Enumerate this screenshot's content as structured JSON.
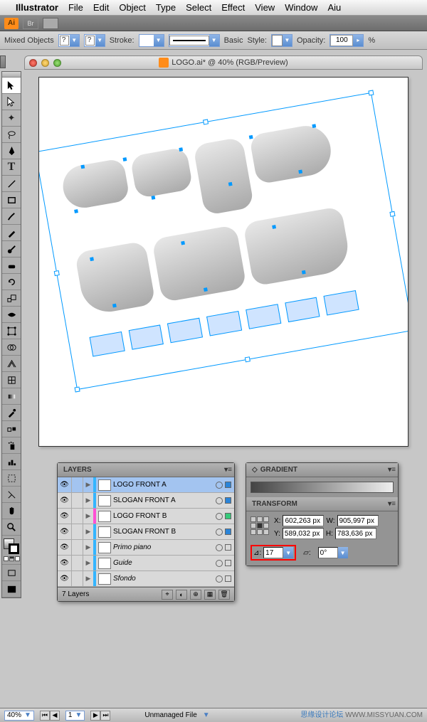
{
  "menubar": {
    "apple": "",
    "app": "Illustrator",
    "items": [
      "File",
      "Edit",
      "Object",
      "Type",
      "Select",
      "Effect",
      "View",
      "Window",
      "Aiu"
    ]
  },
  "toolbar": {
    "ai": "Ai",
    "br": "Br"
  },
  "control": {
    "selection": "Mixed Objects",
    "stroke_label": "Stroke:",
    "stroke_style": "Basic",
    "style_label": "Style:",
    "opacity_label": "Opacity:",
    "opacity_value": "100",
    "pct": "%"
  },
  "window": {
    "title": "LOGO.ai* @ 40% (RGB/Preview)"
  },
  "layers_panel": {
    "title": "LAYERS",
    "rows": [
      {
        "name": "LOGO FRONT A",
        "color": "#34b5ff",
        "selected": true,
        "italic": false,
        "selRect": "#2a84d8"
      },
      {
        "name": "SLOGAN FRONT A",
        "color": "#34b5ff",
        "selected": false,
        "italic": false,
        "selRect": "#2a84d8"
      },
      {
        "name": "LOGO FRONT B",
        "color": "#ff4fd4",
        "selected": false,
        "italic": false,
        "selRect": "#35c97a"
      },
      {
        "name": "SLOGAN FRONT B",
        "color": "#34b5ff",
        "selected": false,
        "italic": false,
        "selRect": "#2a84d8"
      },
      {
        "name": "Primo piano",
        "color": "#34b5ff",
        "selected": false,
        "italic": true,
        "selRect": "transparent"
      },
      {
        "name": "Guide",
        "color": "#34b5ff",
        "selected": false,
        "italic": true,
        "selRect": "transparent"
      },
      {
        "name": "Sfondo",
        "color": "#34b5ff",
        "selected": false,
        "italic": true,
        "selRect": "transparent"
      }
    ],
    "footer": "7 Layers"
  },
  "gradient_panel": {
    "title": "GRADIENT"
  },
  "transform_panel": {
    "title": "TRANSFORM",
    "x_label": "X:",
    "x_value": "602,263 px",
    "y_label": "Y:",
    "y_value": "589,032 px",
    "w_label": "W:",
    "w_value": "905,997 px",
    "h_label": "H:",
    "h_value": "783,636 px",
    "rotate_value": "17",
    "shear_value": "0°"
  },
  "statusbar": {
    "zoom": "40%",
    "page": "1",
    "status": "Unmanaged File"
  },
  "watermark": {
    "cn": "思缘设计论坛",
    "en": "WWW.MISSYUAN.COM"
  },
  "tools": [
    "selection",
    "direct-selection",
    "magic-wand",
    "lasso",
    "pen",
    "type",
    "line",
    "rectangle",
    "paintbrush",
    "pencil",
    "blob-brush",
    "eraser",
    "rotate",
    "scale",
    "width",
    "free-transform",
    "shape-builder",
    "perspective",
    "mesh",
    "gradient",
    "eyedropper",
    "blend",
    "symbol-sprayer",
    "graph",
    "artboard",
    "slice",
    "hand",
    "zoom"
  ]
}
